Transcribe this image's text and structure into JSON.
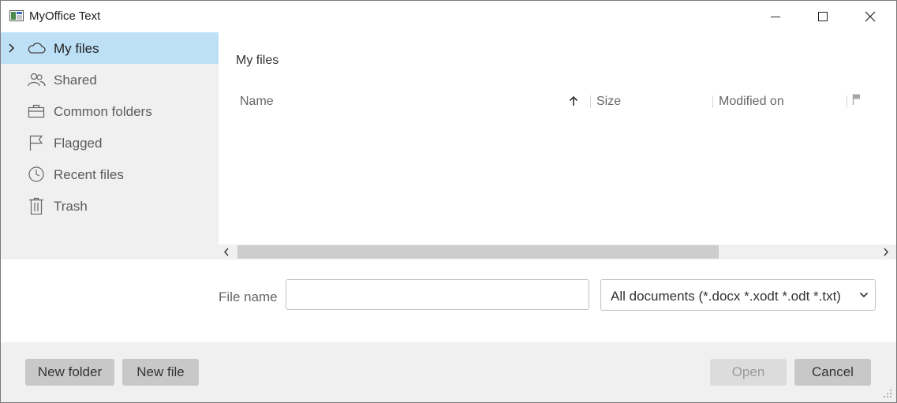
{
  "window": {
    "title": "MyOffice Text"
  },
  "sidebar": {
    "items": [
      {
        "label": "My files",
        "icon": "cloud-icon",
        "active": true
      },
      {
        "label": "Shared",
        "icon": "users-icon"
      },
      {
        "label": "Common folders",
        "icon": "briefcase-icon"
      },
      {
        "label": "Flagged",
        "icon": "flag-icon"
      },
      {
        "label": "Recent files",
        "icon": "clock-icon"
      },
      {
        "label": "Trash",
        "icon": "trash-icon"
      }
    ]
  },
  "main": {
    "breadcrumb": "My files",
    "columns": {
      "name": "Name",
      "size": "Size",
      "modified": "Modified on"
    },
    "sort": {
      "column": "Name",
      "direction": "ascending"
    }
  },
  "file_name": {
    "label": "File name",
    "value": ""
  },
  "filter": {
    "selected": "All documents (*.docx *.xodt *.odt *.txt)"
  },
  "footer": {
    "new_folder": "New folder",
    "new_file": "New file",
    "open": "Open",
    "cancel": "Cancel"
  },
  "colors": {
    "accent_selected": "#bde0f7",
    "panel": "#f0f0f0",
    "button": "#c8c8c8"
  }
}
